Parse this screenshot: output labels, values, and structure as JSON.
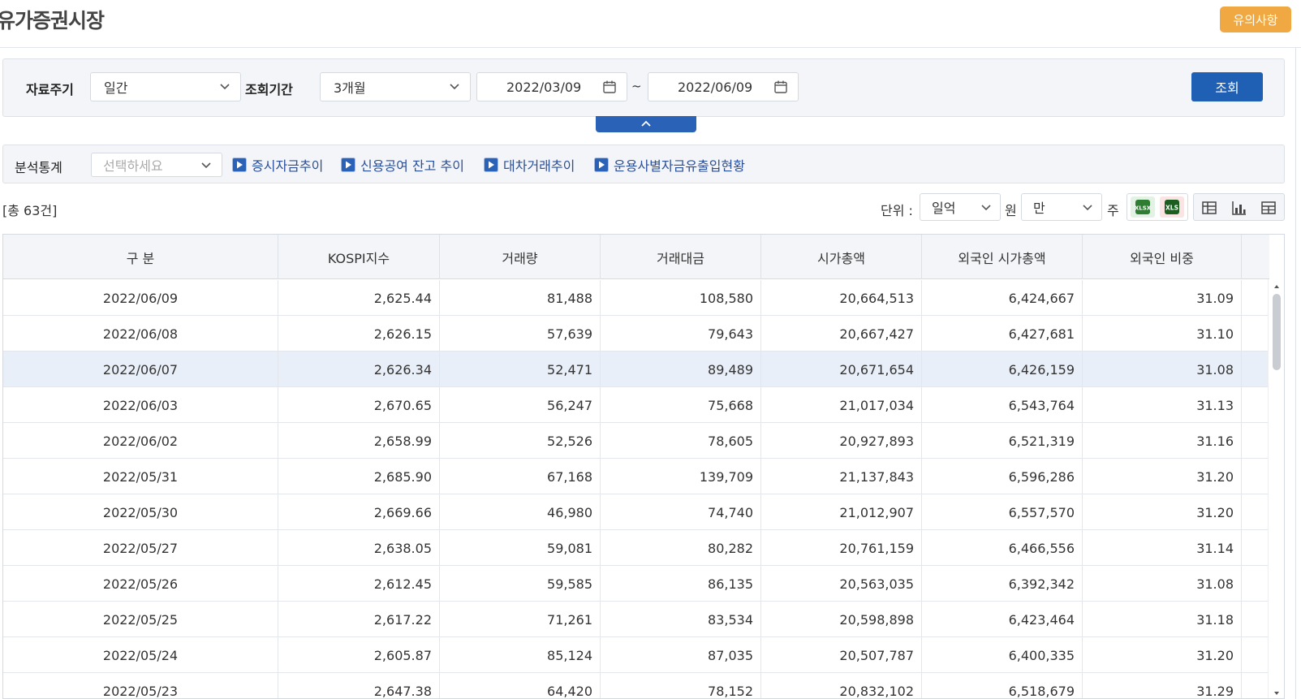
{
  "header": {
    "title": "유가증권시장",
    "notice_label": "유의사항"
  },
  "search": {
    "period_label": "자료주기",
    "period_value": "일간",
    "range_label": "조회기간",
    "range_value": "3개월",
    "date_from": "2022/03/09",
    "tilde": "~",
    "date_to": "2022/06/09",
    "search_label": "조회"
  },
  "analysis": {
    "label": "분석통계",
    "placeholder": "선택하세요",
    "links": [
      "증시자금추이",
      "신용공여 잔고 추이",
      "대차거래추이",
      "운용사별자금유출입현황"
    ]
  },
  "toolbar": {
    "total_count": "[총 63건]",
    "unit_label": "단위 :",
    "unit_money": "일억",
    "unit_money_suffix": "원",
    "unit_share": "만",
    "unit_share_suffix": "주",
    "xlsx_icon": "xlsx-download-icon",
    "xls_icon": "xls-download-icon"
  },
  "table": {
    "columns": [
      "구 분",
      "KOSPI지수",
      "거래량",
      "거래대금",
      "시가총액",
      "외국인 시가총액",
      "외국인 비중"
    ],
    "rows": [
      [
        "2022/06/09",
        "2,625.44",
        "81,488",
        "108,580",
        "20,664,513",
        "6,424,667",
        "31.09"
      ],
      [
        "2022/06/08",
        "2,626.15",
        "57,639",
        "79,643",
        "20,667,427",
        "6,427,681",
        "31.10"
      ],
      [
        "2022/06/07",
        "2,626.34",
        "52,471",
        "89,489",
        "20,671,654",
        "6,426,159",
        "31.08"
      ],
      [
        "2022/06/03",
        "2,670.65",
        "56,247",
        "75,668",
        "21,017,034",
        "6,543,764",
        "31.13"
      ],
      [
        "2022/06/02",
        "2,658.99",
        "52,526",
        "78,605",
        "20,927,893",
        "6,521,319",
        "31.16"
      ],
      [
        "2022/05/31",
        "2,685.90",
        "67,168",
        "139,709",
        "21,137,843",
        "6,596,286",
        "31.20"
      ],
      [
        "2022/05/30",
        "2,669.66",
        "46,980",
        "74,740",
        "21,012,907",
        "6,557,570",
        "31.20"
      ],
      [
        "2022/05/27",
        "2,638.05",
        "59,081",
        "80,282",
        "20,761,159",
        "6,466,556",
        "31.14"
      ],
      [
        "2022/05/26",
        "2,612.45",
        "59,585",
        "86,135",
        "20,563,035",
        "6,392,342",
        "31.08"
      ],
      [
        "2022/05/25",
        "2,617.22",
        "71,261",
        "83,534",
        "20,598,898",
        "6,423,464",
        "31.18"
      ],
      [
        "2022/05/24",
        "2,605.87",
        "85,124",
        "87,035",
        "20,507,787",
        "6,400,335",
        "31.20"
      ],
      [
        "2022/05/23",
        "2,647.38",
        "64,420",
        "78,152",
        "20,832,102",
        "6,518,679",
        "31.29"
      ]
    ],
    "selected_row": 2
  }
}
